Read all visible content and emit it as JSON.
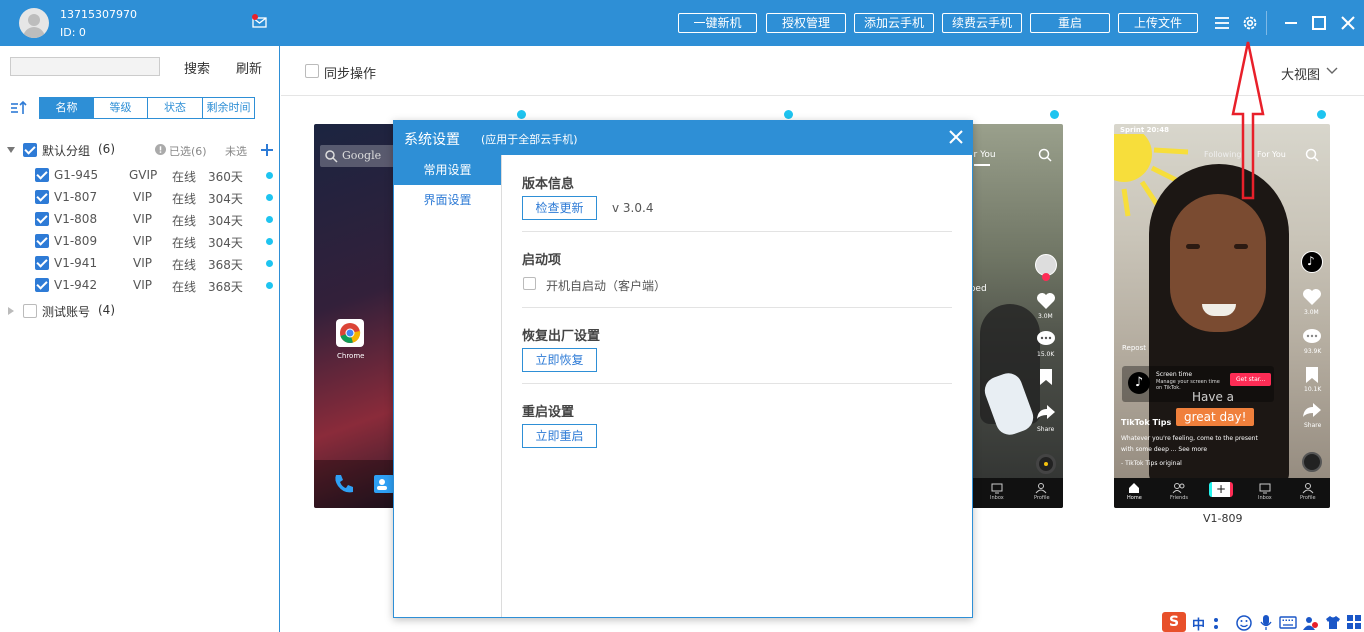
{
  "user": {
    "phone": "13715307970",
    "id": "ID: 0"
  },
  "toolbar": {
    "buttons": [
      "一键新机",
      "授权管理",
      "添加云手机",
      "续费云手机",
      "重启",
      "上传文件"
    ]
  },
  "sidebar": {
    "search_placeholder": "",
    "search_label": "搜索",
    "refresh_label": "刷新",
    "tabs": [
      "名称",
      "等级",
      "状态",
      "剩余时间"
    ],
    "group1": {
      "name": "默认分组",
      "count": "(6)",
      "selected": "已选(6)",
      "unselected": "未选"
    },
    "devices": [
      {
        "name": "G1-945",
        "level": "GVIP",
        "status": "在线",
        "days": "360天"
      },
      {
        "name": "V1-807",
        "level": "VIP",
        "status": "在线",
        "days": "304天"
      },
      {
        "name": "V1-808",
        "level": "VIP",
        "status": "在线",
        "days": "304天"
      },
      {
        "name": "V1-809",
        "level": "VIP",
        "status": "在线",
        "days": "304天"
      },
      {
        "name": "V1-941",
        "level": "VIP",
        "status": "在线",
        "days": "368天"
      },
      {
        "name": "V1-942",
        "level": "VIP",
        "status": "在线",
        "days": "368天"
      }
    ],
    "group2": {
      "name": "测试账号",
      "count": "(4)"
    }
  },
  "main": {
    "sync_label": "同步操作",
    "view_label": "大视图",
    "phone_labels": {
      "p4": "V1-809"
    },
    "phone1": {
      "search": "Google",
      "app": "Chrome"
    },
    "phone3": {
      "tab": "or You",
      "caption": "pped",
      "stat1": "3.0M",
      "stat2": "15.0K",
      "share": "Share",
      "inbox": "Inbox",
      "profile": "Profile"
    },
    "phone4": {
      "status": "Sprint 20:48",
      "following": "Following",
      "foryou": "For You",
      "repost": "Repost",
      "screen_time": "Screen time",
      "screen_time_sub": "Manage your screen time on TikTok.",
      "get_started": "Get star...",
      "sticker1": "Have a",
      "sticker2": "great day!",
      "author": "TikTok Tips",
      "desc": "Whatever you're feeling, come to the present with some deep ... See more",
      "sound": "- TikTok Tips    original",
      "nav": [
        "Home",
        "Friends",
        "",
        "Inbox",
        "Profile"
      ],
      "stats": [
        "3.0M",
        "93.9K",
        "10.1K",
        "Share"
      ]
    }
  },
  "dialog": {
    "title": "系统设置",
    "subtitle": "(应用于全部云手机)",
    "nav": [
      "常用设置",
      "界面设置"
    ],
    "version_title": "版本信息",
    "check_update": "检查更新",
    "version": "v 3.0.4",
    "startup_title": "启动项",
    "autostart": "开机自启动（客户端）",
    "factory_title": "恢复出厂设置",
    "restore_now": "立即恢复",
    "reboot_title": "重启设置",
    "reboot_now": "立即重启"
  },
  "taskbar": {
    "ime": "中"
  },
  "colors": {
    "accent": "#2e8fd6",
    "online_dot": "#1ec4f0",
    "annotation": "#e8202a"
  }
}
